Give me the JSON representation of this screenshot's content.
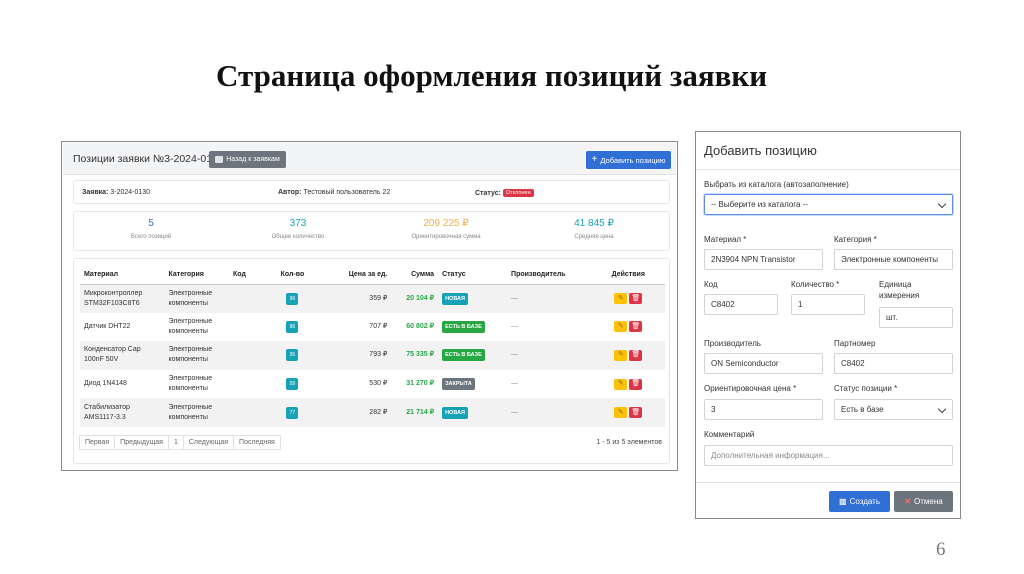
{
  "slide": {
    "title": "Страница оформления позиций заявки",
    "number": "6"
  },
  "colors": {
    "primary": "#2f6fd6",
    "secondary": "#6c757d",
    "success": "#28a745",
    "info": "#17a2b8",
    "danger": "#dc3545",
    "warning": "#ffc107",
    "accent_orange": "#f0ad4e"
  },
  "page": {
    "title": "Позиции заявки №3-2024-0130",
    "back_button": "Назад к заявкам",
    "add_button": "Добавить позицию",
    "info": {
      "request_label": "Заявка:",
      "request_value": "3-2024-0130",
      "author_label": "Автор:",
      "author_value": "Тестовый пользователь 22",
      "status_label": "Статус:",
      "status_value": "Отклонен"
    },
    "stats": [
      {
        "value": "5",
        "label": "Всего позиций",
        "color": "#2f6fd6"
      },
      {
        "value": "373",
        "label": "Общее количество",
        "color": "#17a2b8"
      },
      {
        "value": "209 225 ₽",
        "label": "Ориентировочная сумма",
        "color": "#f0ad4e"
      },
      {
        "value": "41 845 ₽",
        "label": "Средняя цена",
        "color": "#17a2b8"
      }
    ],
    "table": {
      "columns": [
        "Материал",
        "Категория",
        "Код",
        "Кол-во",
        "Цена за ед.",
        "Сумма",
        "Статус",
        "Производитель",
        "Действия"
      ],
      "rows": [
        {
          "material": "Микроконтроллер STM32F103C8T6",
          "category": "Электронные компоненты",
          "code": "",
          "qty": "96",
          "price": "359 ₽",
          "sum": "20 104 ₽",
          "status": "НОВАЯ",
          "status_color": "#17a2b8",
          "maker": "—"
        },
        {
          "material": "Датчик DHT22",
          "category": "Электронные компоненты",
          "code": "",
          "qty": "86",
          "price": "707 ₽",
          "sum": "60 802 ₽",
          "status": "ЕСТЬ В БАЗЕ",
          "status_color": "#28a745",
          "maker": "—"
        },
        {
          "material": "Конденсатор Cap 100nF 50V",
          "category": "Электронные компоненты",
          "code": "",
          "qty": "95",
          "price": "793 ₽",
          "sum": "75 335 ₽",
          "status": "ЕСТЬ В БАЗЕ",
          "status_color": "#28a745",
          "maker": "—"
        },
        {
          "material": "Диод 1N4148",
          "category": "Электронные компоненты",
          "code": "",
          "qty": "59",
          "price": "530 ₽",
          "sum": "31 270 ₽",
          "status": "ЗАКРЫТА",
          "status_color": "#6c757d",
          "maker": "—"
        },
        {
          "material": "Стабилизатор AMS1117-3.3",
          "category": "Электронные компоненты",
          "code": "",
          "qty": "77",
          "price": "282 ₽",
          "sum": "21 714 ₽",
          "status": "НОВАЯ",
          "status_color": "#17a2b8",
          "maker": "—"
        }
      ]
    },
    "pagination": {
      "first": "Первая",
      "prev": "Предыдущая",
      "current": "1",
      "next": "Следующая",
      "last": "Последняя",
      "info": "1 - 5 из 5 элементов"
    }
  },
  "modal": {
    "title": "Добавить позицию",
    "catalog_label": "Выбрать из каталога (автозаполнение)",
    "catalog_value": "-- Выберите из каталога --",
    "material_label": "Материал *",
    "material_value": "2N3904 NPN Transistor",
    "category_label": "Категория *",
    "category_value": "Электронные компоненты",
    "code_label": "Код",
    "code_value": "C8402",
    "qty_label": "Количество *",
    "qty_value": "1",
    "unit_label": "Единица измерения",
    "unit_value": "шт.",
    "maker_label": "Производитель",
    "maker_value": "ON Semiconductor",
    "partno_label": "Партномер",
    "partno_value": "C8402",
    "price_label": "Ориентировочная цена *",
    "price_value": "3",
    "status_label": "Статус позиции *",
    "status_value": "Есть в базе",
    "comment_label": "Комментарий",
    "comment_placeholder": "Дополнительная информация...",
    "create_button": "Создать",
    "cancel_button": "Отмена"
  }
}
